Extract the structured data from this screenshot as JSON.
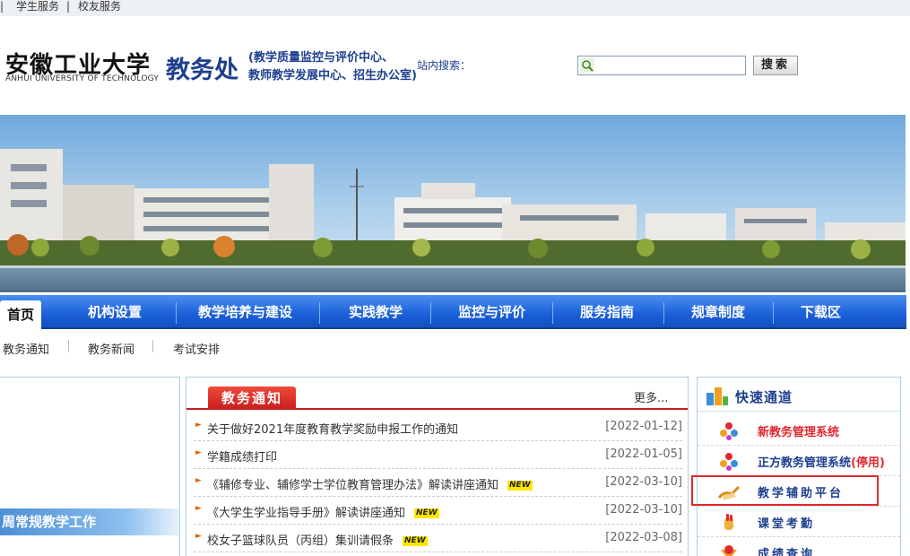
{
  "topbar": {
    "links": [
      "学生服务",
      "校友服务"
    ],
    "sep": "|"
  },
  "header": {
    "logo_cn": "安徽工业大学",
    "logo_en": "ANHUI UNIVERSITY OF TECHNOLOGY",
    "dept": "教务处",
    "subunits_line1": "(教学质量监控与评价中心、",
    "subunits_line2": "教师教学发展中心、招生办公室)",
    "search_label": "站内搜索：",
    "search_value": "",
    "search_button": "搜索"
  },
  "nav": {
    "items": [
      "首页",
      "机构设置",
      "教学培养与建设",
      "实践教学",
      "监控与评价",
      "服务指南",
      "规章制度",
      "下载区"
    ]
  },
  "subnav": {
    "items": [
      "教务通知",
      "教务新闻",
      "考试安排"
    ]
  },
  "left": {
    "title": "周常规教学工作"
  },
  "news": {
    "tab": "教务通知",
    "more": "更多...",
    "badge": "NEW",
    "rows": [
      {
        "title": "关于做好2021年度教育教学奖励申报工作的通知",
        "date": "[2022-01-12]",
        "new": false
      },
      {
        "title": "学籍成绩打印",
        "date": "[2022-01-05]",
        "new": false
      },
      {
        "title": "《辅修专业、辅修学士学位教育管理办法》解读讲座通知",
        "date": "[2022-03-10]",
        "new": true
      },
      {
        "title": "《大学生学业指导手册》解读讲座通知",
        "date": "[2022-03-10]",
        "new": true
      },
      {
        "title": "校女子篮球队员（丙组）集训请假条",
        "date": "[2022-03-08]",
        "new": true
      }
    ]
  },
  "quick": {
    "title": "快速通道",
    "items": [
      {
        "label": "新教务管理系统",
        "color": "#e0282e"
      },
      {
        "label": "正方教务管理系统",
        "suffix": "(停用)",
        "color": "#1d3f8f",
        "suffix_color": "#e0282e"
      },
      {
        "label": "教学辅助平台",
        "color": "#1d3f8f"
      },
      {
        "label": "课堂考勤",
        "color": "#1d3f8f"
      },
      {
        "label": "成绩查询",
        "color": "#1d3f8f"
      }
    ]
  },
  "colors": {
    "nav_blue": "#1a5fd8",
    "news_red": "#c81e1e",
    "title_blue": "#1d3f8f",
    "highlight_red": "#e0282e"
  }
}
